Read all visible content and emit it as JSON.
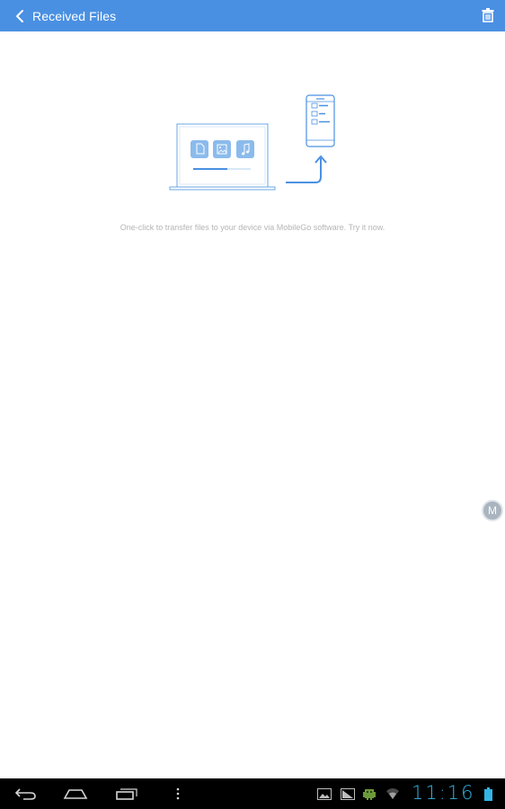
{
  "header": {
    "title": "Received Files",
    "back_icon": "chevron-left-icon",
    "delete_icon": "trash-icon",
    "background": "#4a90e2"
  },
  "main": {
    "hint": "One-click to transfer files to your device via MobileGo software. Try it now.",
    "illustration": "laptop-to-phone-transfer"
  },
  "floating_button": {
    "label": "M"
  },
  "system_bar": {
    "time": "11:16",
    "time_color": "#33b5e5",
    "nav_icons": [
      "back-icon",
      "home-icon",
      "recent-apps-icon",
      "menu-icon"
    ],
    "status_icons": [
      "gallery-notification-icon",
      "screenshot-notification-icon",
      "android-notification-icon",
      "wifi-icon",
      "battery-icon"
    ]
  }
}
